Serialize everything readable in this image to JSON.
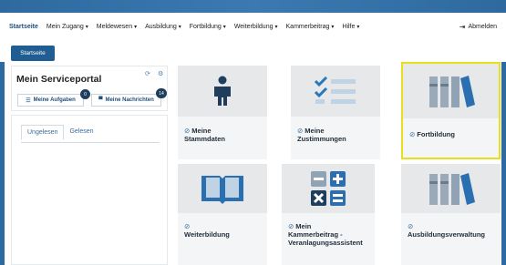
{
  "nav": {
    "items": [
      {
        "label": "Startseite",
        "active": true,
        "chevron": false
      },
      {
        "label": "Mein Zugang",
        "chevron": true
      },
      {
        "label": "Meldewesen",
        "chevron": true
      },
      {
        "label": "Ausbildung",
        "chevron": true
      },
      {
        "label": "Fortbildung",
        "chevron": true
      },
      {
        "label": "Weiterbildung",
        "chevron": true
      },
      {
        "label": "Kammerbeitrag",
        "chevron": true
      },
      {
        "label": "Hilfe",
        "chevron": true
      }
    ],
    "logout": "Abmelden"
  },
  "breadcrumb": {
    "start": "Startseite"
  },
  "portal": {
    "title": "Mein Serviceportal",
    "tasks_label": "Meine Aufgaben",
    "tasks_count": "0",
    "messages_label": "Meine Nachrichten",
    "messages_count": "14"
  },
  "messages": {
    "tabs": [
      "Ungelesen",
      "Gelesen"
    ]
  },
  "cards": [
    {
      "line1": "Meine",
      "line2": "Stammdaten",
      "line3": "",
      "icon": "person-icon"
    },
    {
      "line1": "Meine",
      "line2": "Zustimmungen",
      "line3": "",
      "icon": "checklist-icon"
    },
    {
      "line1": "Fortbildung",
      "line2": "",
      "line3": "",
      "icon": "books-icon",
      "selected": true
    },
    {
      "line1": "",
      "line2": "Weiterbildung",
      "line3": "",
      "icon": "open-book-icon"
    },
    {
      "line1": "Mein",
      "line2": "Kammerbeitrag -",
      "line3": "Veranlagungsassistent",
      "icon": "calculator-icon"
    },
    {
      "line1": "",
      "line2": "Ausbildungsverwaltung",
      "line3": "",
      "icon": "books-icon"
    }
  ],
  "colors": {
    "primary": "#1f5d93",
    "accent": "#3a6c9b",
    "highlight": "#e6e01a",
    "card_bg": "#f4f5f6"
  }
}
